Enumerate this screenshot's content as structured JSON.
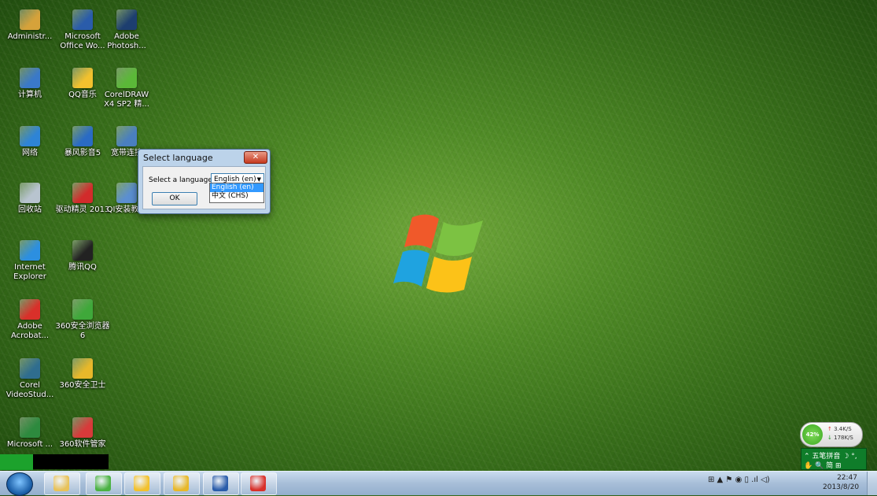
{
  "desktop": {
    "icons": [
      {
        "label": "Administr...",
        "icon": "user-folder-icon",
        "color": "#d6a23a"
      },
      {
        "label": "Microsoft Office Wo...",
        "icon": "word-icon",
        "color": "#2a5caa"
      },
      {
        "label": "Adobe Photosh...",
        "icon": "photoshop-icon",
        "color": "#1d3e6f"
      },
      {
        "label": "计算机",
        "icon": "computer-icon",
        "color": "#3a79c8"
      },
      {
        "label": "QQ音乐",
        "icon": "qq-music-icon",
        "color": "#f2c12e"
      },
      {
        "label": "CorelDRAW X4 SP2 精...",
        "icon": "coreldraw-icon",
        "color": "#5bb838"
      },
      {
        "label": "网络",
        "icon": "network-icon",
        "color": "#2e84d6"
      },
      {
        "label": "暴风影音5",
        "icon": "baofeng-icon",
        "color": "#2a6bc4"
      },
      {
        "label": "宽带连接",
        "icon": "broadband-icon",
        "color": "#4a7fbf"
      },
      {
        "label": "回收站",
        "icon": "recycle-bin-icon",
        "color": "#b8c4cf"
      },
      {
        "label": "驱动精灵 2013",
        "icon": "driver-genius-icon",
        "color": "#d22b2b"
      },
      {
        "label": "QI安装教程",
        "icon": "document-icon",
        "color": "#5b8fd1"
      },
      {
        "label": "Internet Explorer",
        "icon": "ie-icon",
        "color": "#2c8fe0"
      },
      {
        "label": "腾讯QQ",
        "icon": "qq-icon",
        "color": "#222222"
      },
      {
        "label": "Adobe Acrobat...",
        "icon": "acrobat-icon",
        "color": "#d9302a"
      },
      {
        "label": "360安全浏览器6",
        "icon": "360-browser-icon",
        "color": "#3fa83a"
      },
      {
        "label": "Corel VideoStud...",
        "icon": "videostudio-icon",
        "color": "#2f6d8f"
      },
      {
        "label": "360安全卫士",
        "icon": "360-safe-icon",
        "color": "#e8b82a"
      },
      {
        "label": "Microsoft ...",
        "icon": "excel-icon",
        "color": "#2d8a3e"
      },
      {
        "label": "360软件管家",
        "icon": "360-software-icon",
        "color": "#d83a3a"
      }
    ]
  },
  "dialog": {
    "title": "Select language",
    "close_label": "✕",
    "prompt": "Select a language:",
    "selected": "English (en)",
    "arrow": "▼",
    "options": [
      "English (en)",
      "中文 (CHS)"
    ],
    "ok_label": "OK"
  },
  "net_widget": {
    "percent": "42%",
    "up": "3.4K/S",
    "down": "178K/S",
    "up_arrow": "↑",
    "down_arrow": "↓"
  },
  "ime": {
    "row1": "⌃ 五笔拼音 ☽ °,",
    "row2": "✋ 🔍 简 ⊞"
  },
  "taskbar": {
    "buttons": [
      {
        "icon": "explorer-icon",
        "color": "#e8c25a"
      },
      {
        "icon": "360-browser-icon",
        "color": "#4bb243"
      },
      {
        "icon": "qq-music-icon",
        "color": "#f2c12e"
      },
      {
        "icon": "360-safe-icon",
        "color": "#e8b82a"
      },
      {
        "icon": "word-icon",
        "color": "#2a5caa"
      },
      {
        "icon": "acrobat-icon",
        "color": "#d9302a"
      }
    ],
    "tray_text": "⊞  ▲  ⚑  ◉  ▯  .ıl  ◁)",
    "time": "22:47",
    "date": "2013/8/20"
  }
}
